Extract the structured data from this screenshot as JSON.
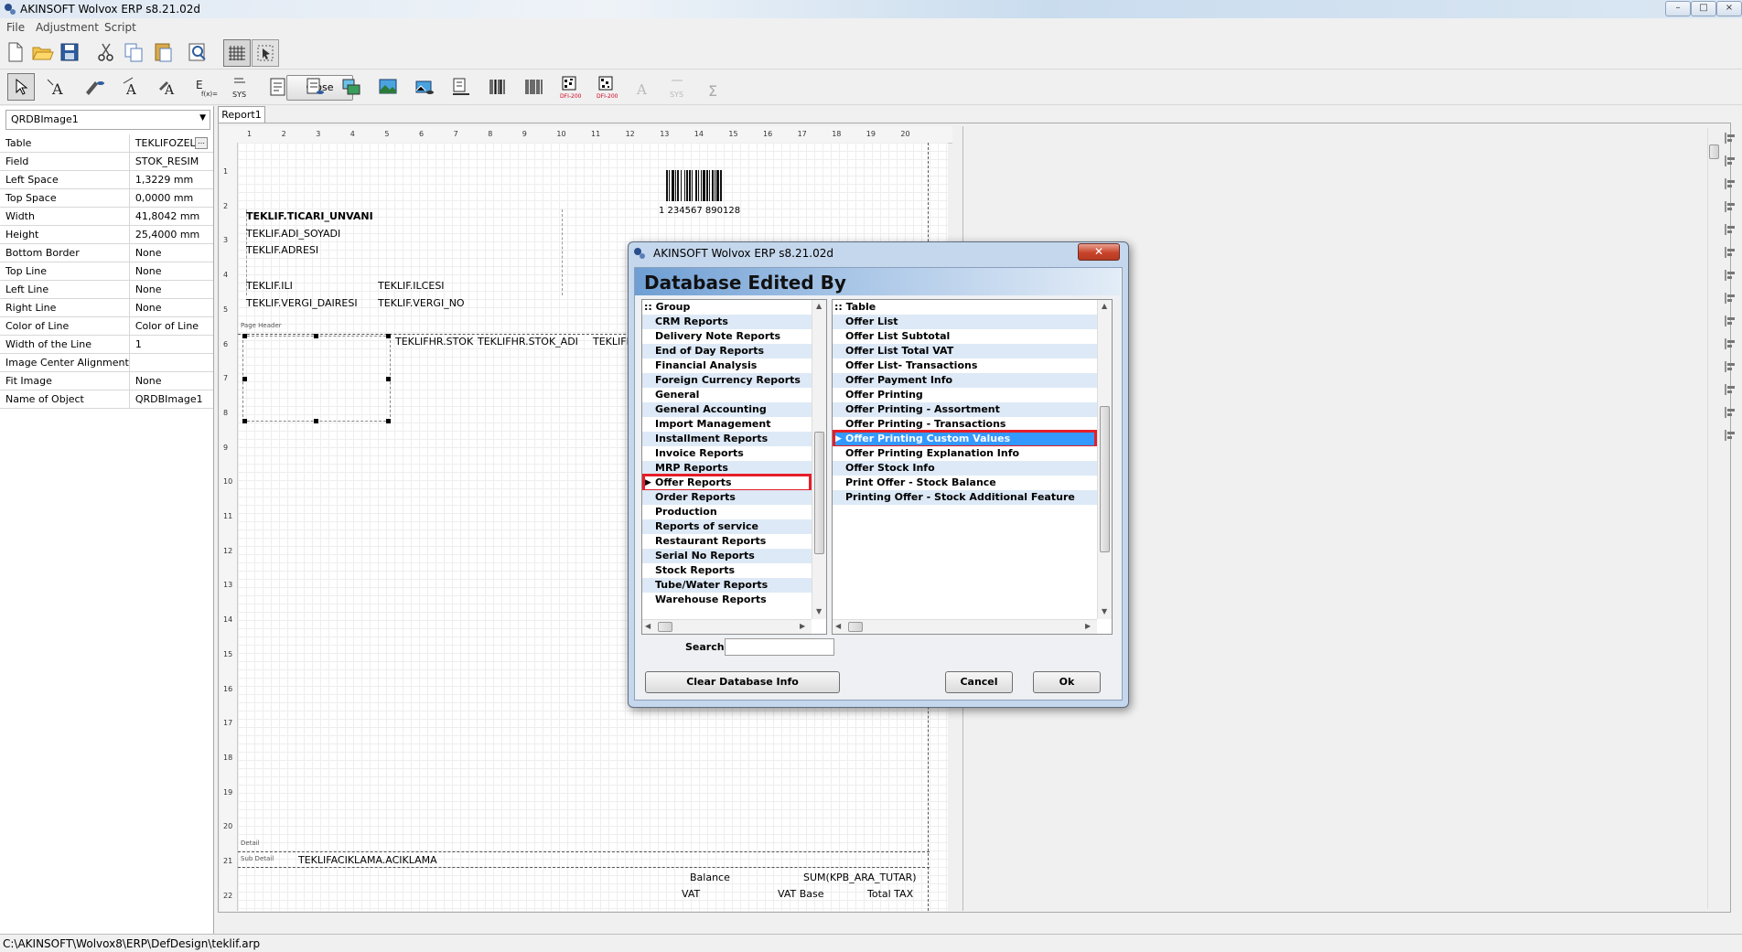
{
  "window": {
    "title": "AKINSOFT Wolvox ERP s8.21.02d",
    "min": "–",
    "max": "□",
    "close": "×"
  },
  "menu": [
    "File",
    "Adjustment",
    "Script"
  ],
  "toolbar": {
    "close_label": "Close"
  },
  "object_selector": {
    "value": "QRDBImage1"
  },
  "properties": [
    {
      "key": "Table",
      "value": "TEKLIFOZEL"
    },
    {
      "key": "Field",
      "value": "STOK_RESIM"
    },
    {
      "key": "Left Space",
      "value": "1,3229 mm"
    },
    {
      "key": "Top Space",
      "value": "0,0000 mm"
    },
    {
      "key": "Width",
      "value": "41,8042 mm"
    },
    {
      "key": "Height",
      "value": "25,4000 mm"
    },
    {
      "key": "Bottom Border",
      "value": "None"
    },
    {
      "key": "Top Line",
      "value": "None"
    },
    {
      "key": "Left Line",
      "value": "None"
    },
    {
      "key": "Right Line",
      "value": "None"
    },
    {
      "key": "Color of Line",
      "value": "Color of Line"
    },
    {
      "key": "Width of the Line",
      "value": "1"
    },
    {
      "key": "Image Center Alignment",
      "value": ""
    },
    {
      "key": "Fit Image",
      "value": "None"
    },
    {
      "key": "Name of Object",
      "value": "QRDBImage1"
    }
  ],
  "report_tab": "Report1",
  "ruler_top": [
    "1",
    "2",
    "3",
    "4",
    "5",
    "6",
    "7",
    "8",
    "9",
    "10",
    "11",
    "12",
    "13",
    "14",
    "15",
    "16",
    "17",
    "18",
    "19",
    "20"
  ],
  "ruler_left": [
    "1",
    "2",
    "3",
    "4",
    "5",
    "6",
    "7",
    "8",
    "9",
    "10",
    "11",
    "12",
    "13",
    "14",
    "15",
    "16",
    "17",
    "18",
    "19",
    "20",
    "21",
    "22"
  ],
  "report_fields": {
    "ticari_unvani": "TEKLIF.TICARI_UNVANI",
    "adi_soyadi": "TEKLIF.ADI_SOYADI",
    "adresi": "TEKLIF.ADRESI",
    "ili": "TEKLIF.ILI",
    "ilcesi": "TEKLIF.ILCESI",
    "vergi_dairesi": "TEKLIF.VERGI_DAIRESI",
    "vergi_no": "TEKLIF.VERGI_NO",
    "stok": "TEKLIFHR.STOK",
    "stok_adi": "TEKLIFHR.STOK_ADI",
    "stok_trunc": "TEKLIFH",
    "aciklama": "TEKLIFACIKLAMA.ACIKLAMA",
    "balance": "Balance",
    "sum_kpb": "SUM(KPB_ARA_TUTAR)",
    "vat": "VAT",
    "vat_base": "VAT Base",
    "total_tax": "Total TAX",
    "barcode_number": "1   234567   890128"
  },
  "band_labels": {
    "page_header": "Page Header",
    "detail": "Detail",
    "sub_detail": "Sub Detail"
  },
  "status_path": "C:\\AKINSOFT\\Wolvox8\\ERP\\DefDesign\\teklif.arp",
  "dialog": {
    "title": "AKINSOFT Wolvox ERP s8.21.02d",
    "close": "✕",
    "heading": "Database Edited By",
    "group_header": ":: Group",
    "groups": [
      "CRM Reports",
      "Delivery Note Reports",
      "End of Day Reports",
      "Financial Analysis",
      "Foreign Currency Reports",
      "General",
      "General Accounting",
      "Import Management",
      "Installment Reports",
      "Invoice Reports",
      "MRP Reports",
      "Offer Reports",
      "Order Reports",
      "Production",
      "Reports of service",
      "Restaurant Reports",
      "Serial No Reports",
      "Stock Reports",
      "Tube/Water Reports",
      "Warehouse Reports"
    ],
    "selected_group": "Offer Reports",
    "table_header": ":: Table",
    "tables": [
      "Offer List",
      "Offer List Subtotal",
      "Offer List Total VAT",
      "Offer List- Transactions",
      "Offer Payment Info",
      "Offer Printing",
      "Offer Printing - Assortment",
      "Offer Printing - Transactions",
      "Offer Printing Custom Values",
      "Offer Printing Explanation Info",
      "Offer Stock Info",
      "Print Offer - Stock Balance",
      "Printing Offer - Stock Additional Feature"
    ],
    "selected_table": "Offer Printing Custom Values",
    "search_label": "Search",
    "search_value": "",
    "clear_label": "Clear Database Info",
    "cancel_label": "Cancel",
    "ok_label": "Ok"
  },
  "colors": {
    "selection": "#3399ff",
    "highlight_outline": "#e51e2a",
    "row_alt": "#dde9f6",
    "dialog_head": "#6e9ed3"
  }
}
